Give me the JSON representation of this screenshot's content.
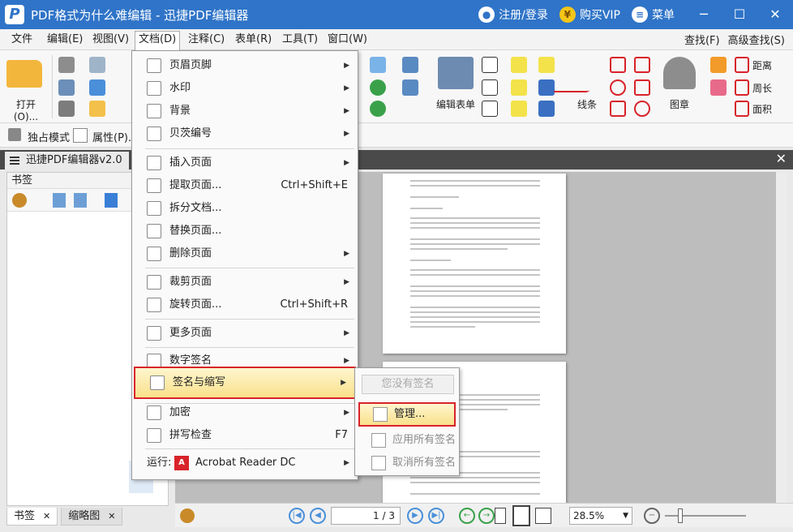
{
  "window": {
    "title": "PDF格式为什么难编辑 - 迅捷PDF编辑器",
    "login": "注册/登录",
    "vip": "购买VIP",
    "menu": "菜单",
    "minimize": "─",
    "maximize": "☐",
    "close": "✕"
  },
  "menubar": {
    "items": [
      "文件",
      "编辑(E)",
      "视图(V)",
      "文档(D)",
      "注释(C)",
      "表单(R)",
      "工具(T)",
      "窗口(W)"
    ],
    "find": "查找(F)",
    "advanced_find": "高级查找(S)"
  },
  "toolbar": {
    "open": "打开(O)...",
    "edit_form": "编辑表单",
    "line": "线条",
    "stamp": "图章",
    "distance": "距离",
    "perimeter": "周长",
    "area": "面积",
    "exclusive": "独占模式",
    "properties": "属性(P)..."
  },
  "tabs": {
    "doc_tab": "迅捷PDF编辑器v2.0"
  },
  "left_panel": {
    "header": "书签",
    "bottom_tabs": [
      "书签",
      "缩略图"
    ]
  },
  "status": {
    "page_current": "1",
    "page_total": "3",
    "zoom": "28.5%"
  },
  "document_menu": {
    "items": [
      {
        "label": "页眉页脚",
        "shortcut": ""
      },
      {
        "label": "水印",
        "shortcut": ""
      },
      {
        "label": "背景",
        "shortcut": ""
      },
      {
        "label": "贝茨编号",
        "shortcut": ""
      },
      {
        "label": "插入页面",
        "shortcut": ""
      },
      {
        "label": "提取页面...",
        "shortcut": "Ctrl+Shift+E"
      },
      {
        "label": "拆分文档...",
        "shortcut": ""
      },
      {
        "label": "替换页面...",
        "shortcut": ""
      },
      {
        "label": "删除页面",
        "shortcut": ""
      },
      {
        "label": "裁剪页面",
        "shortcut": ""
      },
      {
        "label": "旋转页面...",
        "shortcut": "Ctrl+Shift+R"
      },
      {
        "label": "更多页面",
        "shortcut": ""
      },
      {
        "label": "数字签名",
        "shortcut": ""
      },
      {
        "label": "签名与缩写",
        "shortcut": ""
      },
      {
        "label": "加密",
        "shortcut": ""
      },
      {
        "label": "拼写检查",
        "shortcut": "F7"
      },
      {
        "label": "运行:",
        "shortcut": ""
      }
    ],
    "run_app": "Acrobat Reader DC"
  },
  "submenu": {
    "no_signature": "您没有签名",
    "manage": "管理...",
    "apply_all": "应用所有签名",
    "cancel_all": "取消所有签名"
  }
}
